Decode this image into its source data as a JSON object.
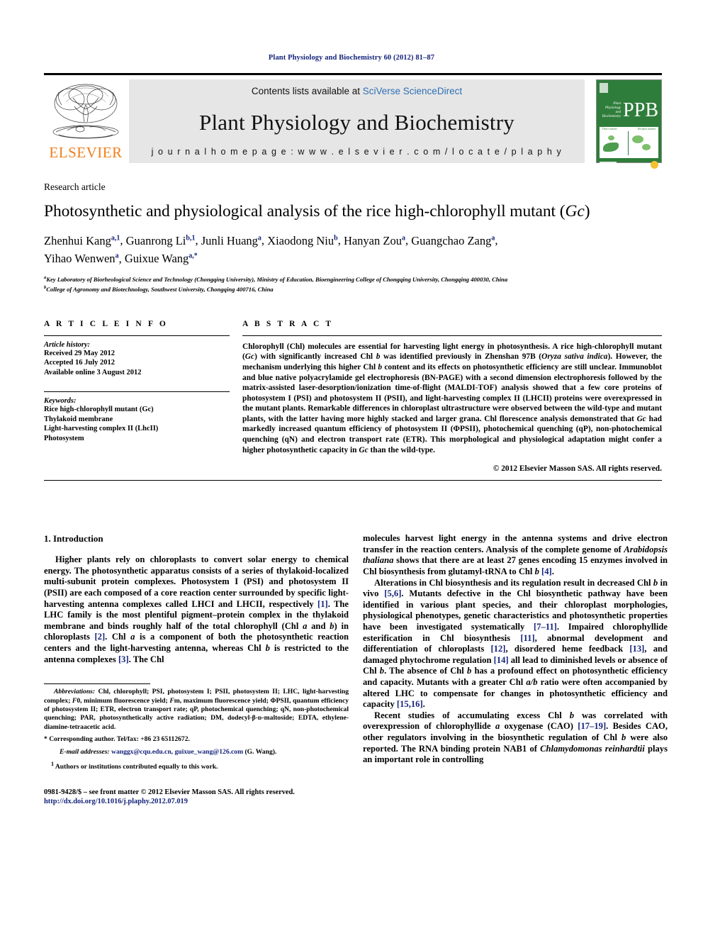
{
  "running_head": "Plant Physiology and Biochemistry 60 (2012) 81–87",
  "masthead": {
    "publisher_name": "ELSEVIER",
    "contents_prefix": "Contents lists available at ",
    "contents_link": "SciVerse ScienceDirect",
    "journal_title": "Plant Physiology and Biochemistry",
    "homepage": "j o u r n a l   h o m e p a g e :   w w w . e l s e v i e r . c o m / l o c a t e / p l a p h y",
    "cover": {
      "letters": "PPB",
      "journal_name_lines": [
        "Plant",
        "Physiology",
        "and",
        "Biochemistry"
      ],
      "figure_label_left": "Direct transfer",
      "figure_label_right": "Receptor transfer"
    }
  },
  "article": {
    "type": "Research article",
    "title_main": "Photosynthetic and physiological analysis of the rice high-chlorophyll mutant (",
    "title_italic": "Gc",
    "title_end": ")",
    "authors_line1": "Zhenhui Kang",
    "authors": [
      {
        "name": "Zhenhui Kang",
        "sup": "a,1"
      },
      {
        "name": "Guanrong Li",
        "sup": "b,1"
      },
      {
        "name": "Junli Huang",
        "sup": "a"
      },
      {
        "name": "Xiaodong Niu",
        "sup": "b"
      },
      {
        "name": "Hanyan Zou",
        "sup": "a"
      },
      {
        "name": "Guangchao Zang",
        "sup": "a"
      },
      {
        "name": "Yihao Wenwen",
        "sup": "a"
      },
      {
        "name": "Guixue Wang",
        "sup": "a,*"
      }
    ],
    "affiliations": [
      {
        "sup": "a",
        "text": "Key Laboratory of Biorheological Science and Technology (Chongqing University), Ministry of Education, Bioengineering College of Chongqing University, Chongqing 400030, China"
      },
      {
        "sup": "b",
        "text": "College of Agronomy and Biotechnology, Southwest University, Chongqing 400716, China"
      }
    ]
  },
  "info": {
    "heading": "A R T I C L E   I N F O",
    "history_label": "Article history:",
    "history": [
      "Received 29 May 2012",
      "Accepted 16 July 2012",
      "Available online 3 August 2012"
    ],
    "keywords_label": "Keywords:",
    "keywords": [
      "Rice high-chlorophyll mutant (Gc)",
      "Thylakoid membrane",
      "Light-harvesting complex II (LhcII)",
      "Photosystem"
    ]
  },
  "abstract": {
    "heading": "A B S T R A C T",
    "text_parts": [
      {
        "t": "Chlorophyll (Chl) molecules are essential for harvesting light energy in photosynthesis. A rice high-chlorophyll mutant ("
      },
      {
        "i": "Gc"
      },
      {
        "t": ") with significantly increased Chl "
      },
      {
        "i": "b"
      },
      {
        "t": " was identified previously in Zhenshan 97B ("
      },
      {
        "i": "Oryza sativa indica"
      },
      {
        "t": "). However, the mechanism underlying this higher Chl "
      },
      {
        "i": "b"
      },
      {
        "t": " content and its effects on photosynthetic efficiency are still unclear. Immunoblot and blue native polyacrylamide gel electrophoresis (BN-PAGE) with a second dimension electrophoresis followed by the matrix-assisted laser-desorption/ionization time-of-flight (MALDI-TOF) analysis showed that a few core proteins of photosystem I (PSI) and photosystem II (PSII), and light-harvesting complex II (LHCII) proteins were overexpressed in the mutant plants. Remarkable differences in chloroplast ultrastructure were observed between the wild-type and mutant plants, with the latter having more highly stacked and larger grana. Chl florescence analysis demonstrated that "
      },
      {
        "i": "Gc"
      },
      {
        "t": " had markedly increased quantum efficiency of photosystem II (ΦPSII), photochemical quenching (qP), non-photochemical quenching (qN) and electron transport rate (ETR). This morphological and physiological adaptation might confer a higher photosynthetic capacity in "
      },
      {
        "i": "Gc"
      },
      {
        "t": " than the wild-type."
      }
    ],
    "copyright": "© 2012 Elsevier Masson SAS. All rights reserved."
  },
  "body": {
    "section_heading": "1. Introduction",
    "left_paragraphs": [
      [
        {
          "t": "Higher plants rely on chloroplasts to convert solar energy to chemical energy. The photosynthetic apparatus consists of a series of thylakoid-localized multi-subunit protein complexes. Photosystem I (PSI) and photosystem II (PSII) are each composed of a core reaction center surrounded by specific light-harvesting antenna complexes called LHCI and LHCII, respectively "
        },
        {
          "c": "[1]"
        },
        {
          "t": ". The LHC family is the most plentiful pigment–protein complex in the thylakoid membrane and binds roughly half of the total chlorophyll (Chl "
        },
        {
          "i": "a"
        },
        {
          "t": " and "
        },
        {
          "i": "b"
        },
        {
          "t": ") in chloroplasts "
        },
        {
          "c": "[2]"
        },
        {
          "t": ". Chl "
        },
        {
          "i": "a"
        },
        {
          "t": " is a component of both the photosynthetic reaction centers and the light-harvesting antenna, whereas Chl "
        },
        {
          "i": "b"
        },
        {
          "t": " is restricted to the antenna complexes "
        },
        {
          "c": "[3]"
        },
        {
          "t": ". The Chl"
        }
      ]
    ],
    "right_paragraphs": [
      [
        {
          "t": "molecules harvest light energy in the antenna systems and drive electron transfer in the reaction centers. Analysis of the complete genome of "
        },
        {
          "i": "Arabidopsis thaliana"
        },
        {
          "t": " shows that there are at least 27 genes encoding 15 enzymes involved in Chl biosynthesis from glutamyl-tRNA to Chl "
        },
        {
          "i": "b"
        },
        {
          "t": " "
        },
        {
          "c": "[4]"
        },
        {
          "t": "."
        }
      ],
      [
        {
          "t": "Alterations in Chl biosynthesis and its regulation result in decreased Chl "
        },
        {
          "i": "b"
        },
        {
          "t": " in vivo "
        },
        {
          "c": "[5,6]"
        },
        {
          "t": ". Mutants defective in the Chl biosynthetic pathway have been identified in various plant species, and their chloroplast morphologies, physiological phenotypes, genetic characteristics and photosynthetic properties have been investigated systematically "
        },
        {
          "c": "[7–11]"
        },
        {
          "t": ". Impaired chlorophyllide esterification in Chl biosynthesis "
        },
        {
          "c": "[11]"
        },
        {
          "t": ", abnormal development and differentiation of chloroplasts "
        },
        {
          "c": "[12]"
        },
        {
          "t": ", disordered heme feedback "
        },
        {
          "c": "[13]"
        },
        {
          "t": ", and damaged phytochrome regulation "
        },
        {
          "c": "[14]"
        },
        {
          "t": " all lead to diminished levels or absence of Chl "
        },
        {
          "i": "b"
        },
        {
          "t": ". The absence of Chl "
        },
        {
          "i": "b"
        },
        {
          "t": " has a profound effect on photosynthetic efficiency and capacity. Mutants with a greater Chl "
        },
        {
          "i": "a/b"
        },
        {
          "t": " ratio were often accompanied by altered LHC to compensate for changes in photosynthetic efficiency and capacity "
        },
        {
          "c": "[15,16]"
        },
        {
          "t": "."
        }
      ],
      [
        {
          "t": "Recent studies of accumulating excess Chl "
        },
        {
          "i": "b"
        },
        {
          "t": " was correlated with overexpression of chlorophyllide "
        },
        {
          "i": "a"
        },
        {
          "t": " oxygenase (CAO) "
        },
        {
          "c": "[17–19]"
        },
        {
          "t": ". Besides CAO, other regulators involving in the biosynthetic regulation of Chl "
        },
        {
          "i": "b"
        },
        {
          "t": " were also reported. The RNA binding protein NAB1 of "
        },
        {
          "i": "Chlamydomonas reinhardtii"
        },
        {
          "t": " plays an important role in controlling"
        }
      ]
    ]
  },
  "footnotes": {
    "abbreviations_parts": [
      {
        "i": "Abbreviations:"
      },
      {
        "t": " Chl, chlorophyll; PSI, photosystem I; PSII, photosystem II; LHC, light-harvesting complex; "
      },
      {
        "i": "F"
      },
      {
        "t": "0, minimum fluorescence yield; "
      },
      {
        "i": "F"
      },
      {
        "t": "m, maximum fluorescence yield; ΦPSII, quantum efficiency of photosystem II; ETR, electron transport rate; qP, photochemical quenching; qN, non-photochemical quenching; PAR, photosynthetically active radiation; DM, dodecyl-β-ᴅ-maltoside; EDTA, ethylene-diamine-tetraacetic acid."
      }
    ],
    "corresponding": "* Corresponding author. Tel/fax: +86 23 65112672.",
    "email_label": "E-mail addresses:",
    "emails": "wanggx@cqu.edu.cn, guixue_wang@126.com",
    "email_suffix": " (G. Wang).",
    "equal_contrib_sup": "1",
    "equal_contrib": "Authors or institutions contributed equally to this work.",
    "issn_line": "0981-9428/$ – see front matter © 2012 Elsevier Masson SAS. All rights reserved.",
    "doi": "http://dx.doi.org/10.1016/j.plaphy.2012.07.019"
  }
}
